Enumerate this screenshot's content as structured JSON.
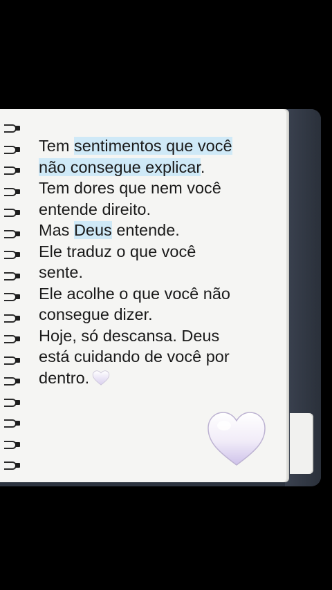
{
  "note": {
    "line1_pre": "Tem ",
    "line1_hl": "sentimentos que você",
    "line2_hl": "não consegue explicar",
    "line2_post": ".",
    "line3": "Tem dores que nem você",
    "line4": "entende direito.",
    "line5_pre": "Mas ",
    "line5_hl": "Deus",
    "line5_post": " entende.",
    "line6": "Ele traduz o que você",
    "line7": "sente.",
    "line8": "Ele acolhe o que você não",
    "line9": "consegue dizer.",
    "line10": "Hoje, só descansa. Deus",
    "line11": "está cuidando de você por",
    "line12": "dentro."
  },
  "colors": {
    "highlight": "#cfe9f7",
    "paper": "#f5f5f3",
    "cover": "#2d3440",
    "heart": "#e9e3f5"
  },
  "icons": [
    "white-heart-icon",
    "large-white-heart-icon",
    "spiral-ring-icon"
  ]
}
